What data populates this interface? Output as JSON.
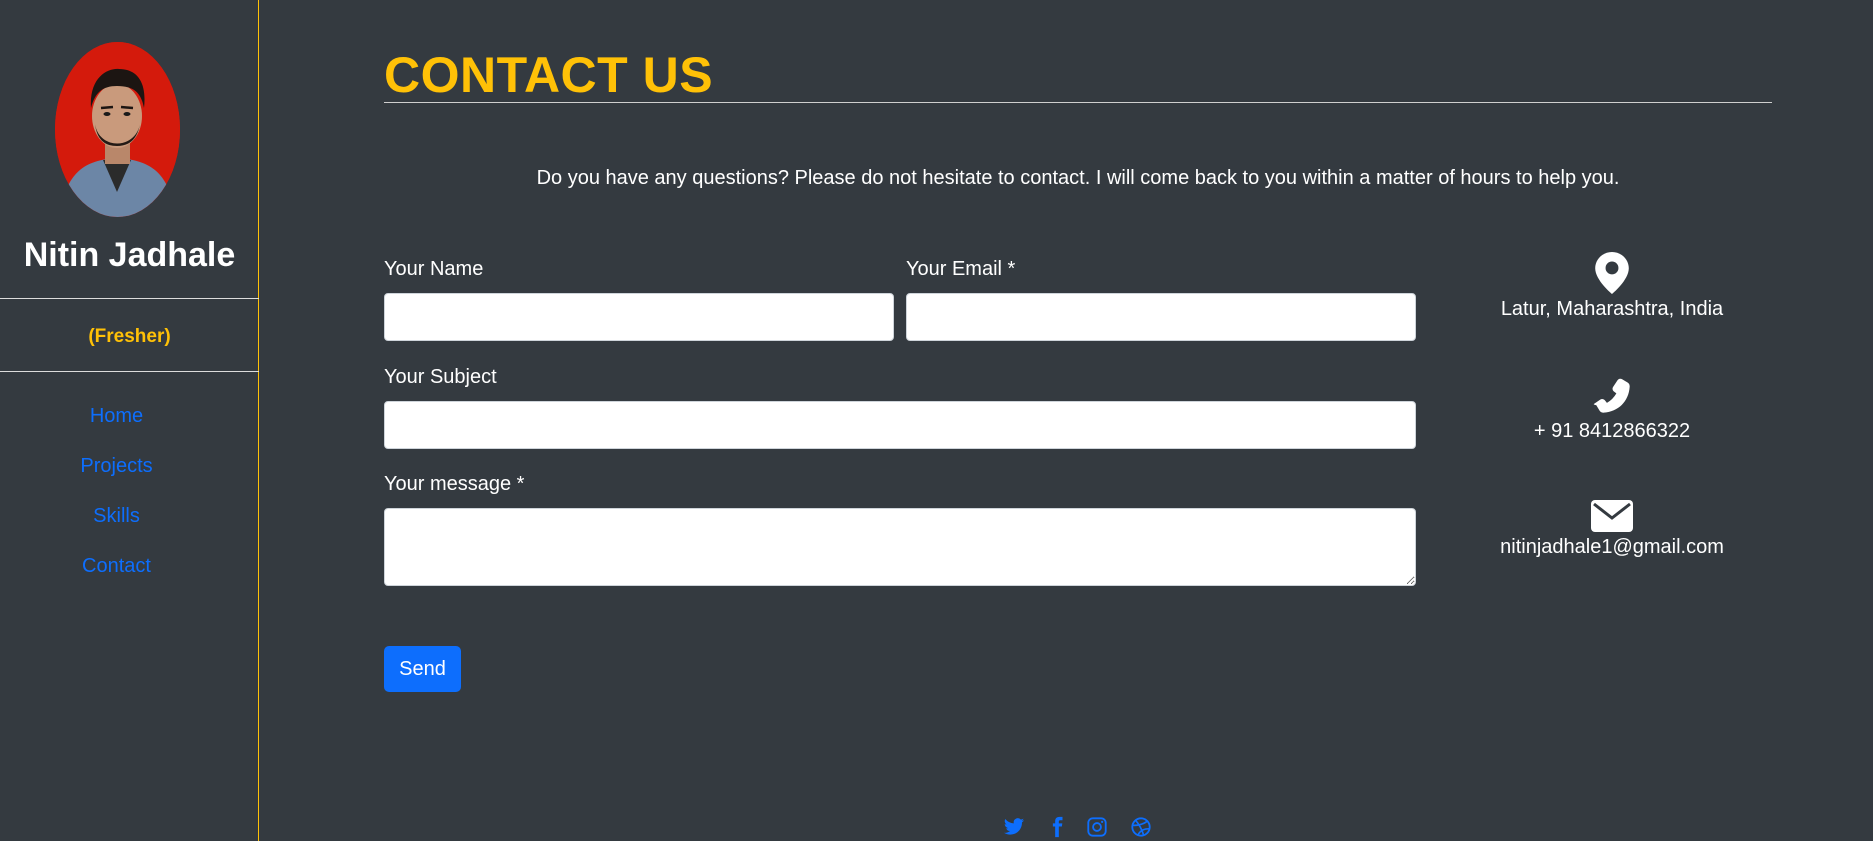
{
  "sidebar": {
    "name": "Nitin Jadhale",
    "role": "(Fresher)",
    "nav": [
      {
        "label": "Home"
      },
      {
        "label": "Projects"
      },
      {
        "label": "Skills"
      },
      {
        "label": "Contact"
      }
    ]
  },
  "main": {
    "title": "CONTACT US",
    "intro": "Do you have any questions? Please do not hesitate to contact. I will come back to you within a matter of hours to help you.",
    "form": {
      "name_label": "Your Name",
      "name_value": "",
      "email_label": "Your Email *",
      "email_value": "",
      "subject_label": "Your Subject",
      "subject_value": "",
      "message_label": "Your message *",
      "message_value": "",
      "send_label": "Send"
    },
    "info": {
      "address": "Latur, Maharashtra, India",
      "phone": "+ 91 8412866322",
      "email": "nitinjadhale1@gmail.com"
    }
  },
  "social": [
    {
      "icon": "twitter-icon"
    },
    {
      "icon": "facebook-icon"
    },
    {
      "icon": "instagram-icon"
    },
    {
      "icon": "dribbble-icon"
    }
  ],
  "colors": {
    "background": "#343a40",
    "accent": "#ffc107",
    "link": "#0d6efd",
    "avatar_bg": "#d41a0c"
  }
}
